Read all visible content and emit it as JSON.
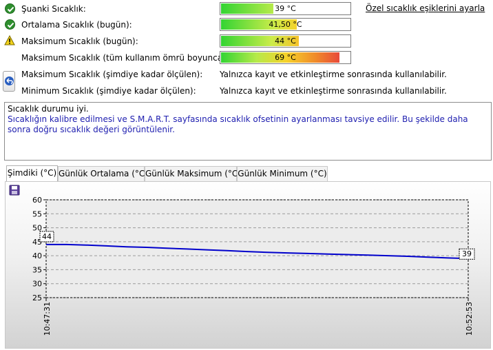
{
  "rows": [
    {
      "label": "Şuanki Sıcaklık:",
      "status": "ok",
      "value": "39 °C",
      "fill": 0.39
    },
    {
      "label": "Ortalama Sıcaklık (bugün):",
      "status": "ok",
      "value": "41,50 °C",
      "fill": 0.415
    },
    {
      "label": "Maksimum Sıcaklık (bugün):",
      "status": "warning",
      "value": "44 °C",
      "fill": 0.44
    },
    {
      "label": "Maksimum Sıcaklık (tüm kullanım ömrü boyunca):",
      "status": "none",
      "value": "69 °C",
      "fill": 0.9
    },
    {
      "label": "Maksimum Sıcaklık (şimdiye kadar ölçülen):",
      "status": "none",
      "info": "Yalnızca kayıt ve etkinleştirme sonrasında kullanılabilir."
    },
    {
      "label": "Minimum Sıcaklık (şimdiye kadar ölçülen):",
      "status": "none",
      "info": "Yalnızca kayıt ve etkinleştirme sonrasında kullanılabilir."
    }
  ],
  "threshold_link": "Özel sıcaklık eşiklerini ayarla",
  "status_text": {
    "line1": "Sıcaklık durumu iyi.",
    "line2": "Sıcaklığın kalibre edilmesi ve S.M.A.R.T. sayfasında sıcaklık ofsetinin ayarlanması tavsiye edilir. Bu şekilde daha sonra doğru sıcaklık değeri görüntülenir."
  },
  "tabs": [
    "Şimdiki (°C)",
    "Günlük Ortalama (°C)",
    "Günlük Maksimum (°C)",
    "Günlük Minimum (°C)"
  ],
  "active_tab": 0,
  "colors": {
    "series": "#0000cc",
    "ok": "#2f8f2f",
    "warning": "#f2d21b",
    "link": "#000000",
    "status_line2": "#2020b0"
  },
  "chart_data": {
    "type": "line",
    "x": [
      "10:47:31",
      "10:52:53"
    ],
    "series": [
      {
        "values_x": [
          0,
          1,
          2,
          3,
          4,
          5,
          6,
          7,
          8,
          9,
          10,
          11,
          12,
          13,
          14,
          15,
          16,
          17,
          18,
          19,
          20,
          21
        ],
        "values": [
          44,
          44,
          43.8,
          43.5,
          43.2,
          43,
          42.7,
          42.4,
          42.1,
          41.8,
          41.5,
          41.2,
          41,
          40.8,
          40.6,
          40.4,
          40.2,
          40,
          39.8,
          39.5,
          39.2,
          39
        ]
      }
    ],
    "ylim": [
      25,
      60
    ],
    "yticks": [
      25,
      30,
      35,
      40,
      45,
      50,
      55,
      60
    ],
    "start_label": "44",
    "end_label": "39",
    "grid": true
  }
}
